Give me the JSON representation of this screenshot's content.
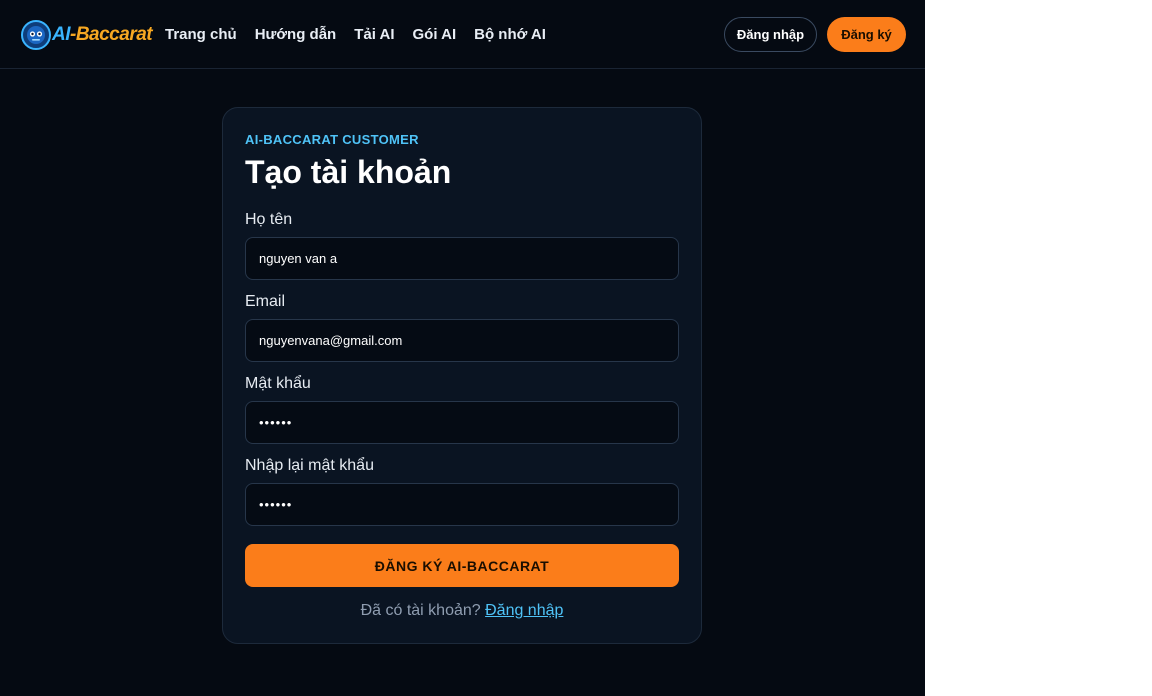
{
  "brand": {
    "logo_ai": "AI",
    "logo_rest": "-Baccarat",
    "accent": "#fb7d1a",
    "highlight": "#4fc3f7",
    "background": "#050a12",
    "card_background": "#0a1422"
  },
  "nav": {
    "items": [
      {
        "label": "Trang chủ"
      },
      {
        "label": "Hướng dẫn"
      },
      {
        "label": "Tải AI"
      },
      {
        "label": "Gói AI"
      },
      {
        "label": "Bộ nhớ AI"
      }
    ]
  },
  "header": {
    "login_label": "Đăng nhập",
    "register_label": "Đăng ký"
  },
  "form": {
    "eyebrow": "AI-BACCARAT CUSTOMER",
    "title": "Tạo tài khoản",
    "fields": [
      {
        "label": "Họ tên",
        "value": "nguyen van a",
        "type": "text"
      },
      {
        "label": "Email",
        "value": "nguyenvana@gmail.com",
        "type": "email"
      },
      {
        "label": "Mật khẩu",
        "value": "123456",
        "type": "password"
      },
      {
        "label": "Nhập lại mật khẩu",
        "value": "123456",
        "type": "password"
      }
    ],
    "submit_label": "ĐĂNG KÝ AI-BACCARAT",
    "have_account_text": "Đã có tài khoản?",
    "login_link": "Đăng nhập"
  }
}
